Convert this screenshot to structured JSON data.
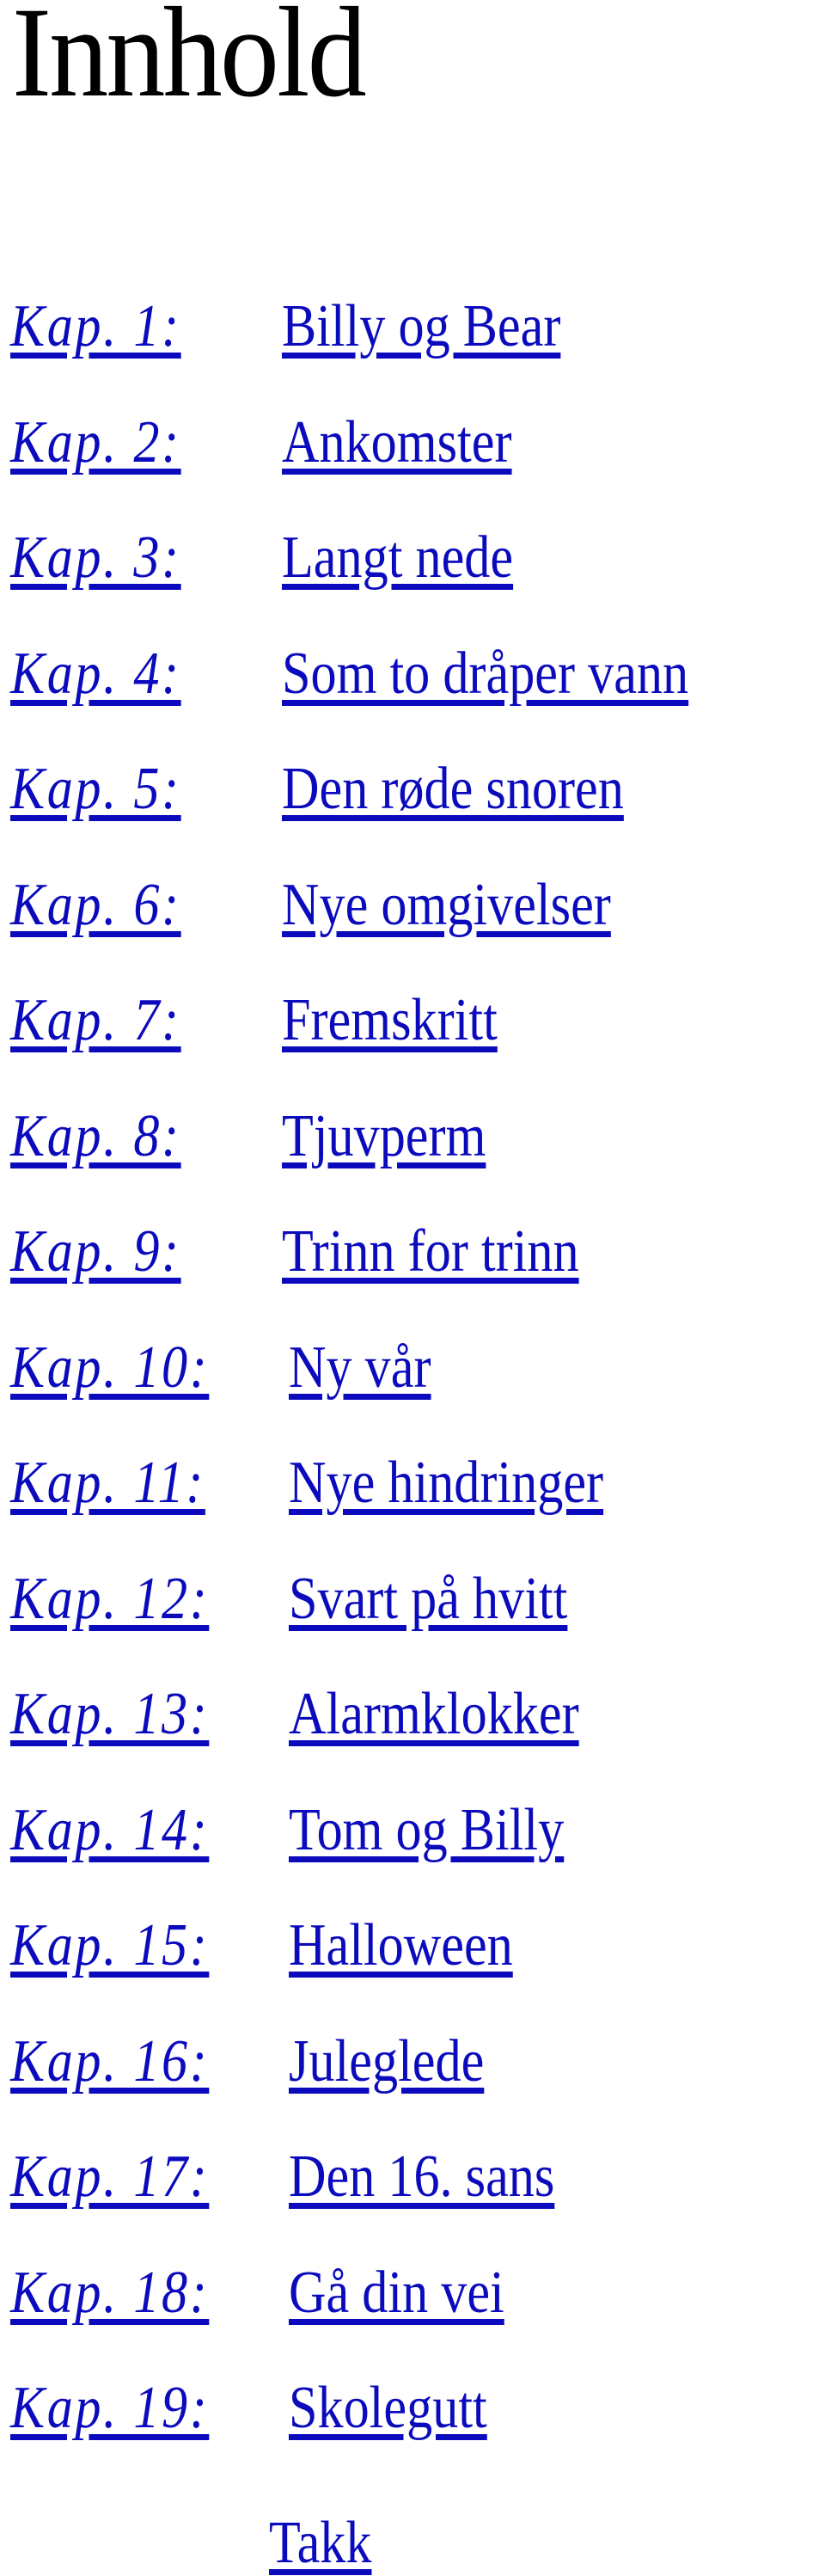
{
  "page_title": "Innhold",
  "chapters": [
    {
      "label": "Kap. 1:",
      "title": "Billy og Bear"
    },
    {
      "label": "Kap. 2:",
      "title": "Ankomster"
    },
    {
      "label": "Kap. 3:",
      "title": "Langt nede"
    },
    {
      "label": "Kap. 4:",
      "title": "Som to dråper vann"
    },
    {
      "label": "Kap. 5:",
      "title": "Den røde snoren"
    },
    {
      "label": "Kap. 6:",
      "title": "Nye omgivelser"
    },
    {
      "label": "Kap. 7:",
      "title": "Fremskritt"
    },
    {
      "label": "Kap. 8:",
      "title": "Tjuvperm"
    },
    {
      "label": "Kap. 9:",
      "title": "Trinn for trinn"
    },
    {
      "label": "Kap. 10:",
      "title": "Ny vår"
    },
    {
      "label": "Kap. 11:",
      "title": "Nye hindringer"
    },
    {
      "label": "Kap. 12:",
      "title": "Svart på hvitt"
    },
    {
      "label": "Kap. 13:",
      "title": "Alarmklokker"
    },
    {
      "label": "Kap. 14:",
      "title": "Tom og Billy"
    },
    {
      "label": "Kap. 15:",
      "title": "Halloween"
    },
    {
      "label": "Kap. 16:",
      "title": "Juleglede"
    },
    {
      "label": "Kap. 17:",
      "title": "Den 16. sans"
    },
    {
      "label": "Kap. 18:",
      "title": "Gå din vei"
    },
    {
      "label": "Kap. 19:",
      "title": "Skolegutt"
    }
  ],
  "closing_link": "Takk",
  "colors": {
    "link": "#0b0bbd",
    "heading": "#000000",
    "background": "#ffffff"
  }
}
